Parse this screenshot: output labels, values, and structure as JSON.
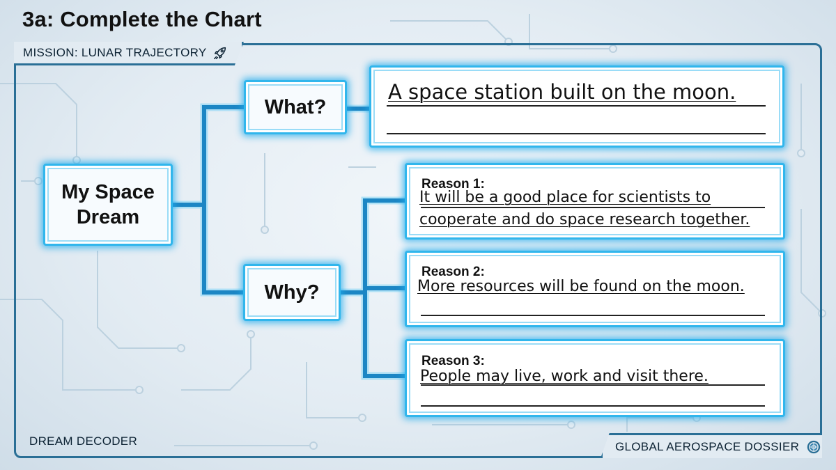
{
  "title": "3a: Complete the Chart",
  "mission_label": "MISSION: LUNAR TRAJECTORY",
  "footer_left": "DREAM DECODER",
  "footer_right": "GLOBAL AEROSPACE DOSSIER",
  "icons": {
    "mission": "rocket-icon",
    "dossier": "globe-icon"
  },
  "colors": {
    "node_border": "#31b6ec",
    "connector": "#1c86c4",
    "frame": "#2a6f96",
    "text": "#111111"
  },
  "diagram": {
    "center": "My Space Dream",
    "what_label": "What?",
    "why_label": "Why?",
    "what_answer": "A space station built on the moon.",
    "reasons": [
      {
        "label": "Reason 1:",
        "lines": [
          "It will be a good place for scientists to",
          "cooperate and do space research together."
        ]
      },
      {
        "label": "Reason 2:",
        "lines": [
          "More resources will be found on the moon."
        ]
      },
      {
        "label": "Reason 3:",
        "lines": [
          "People may live, work and visit there."
        ]
      }
    ]
  }
}
